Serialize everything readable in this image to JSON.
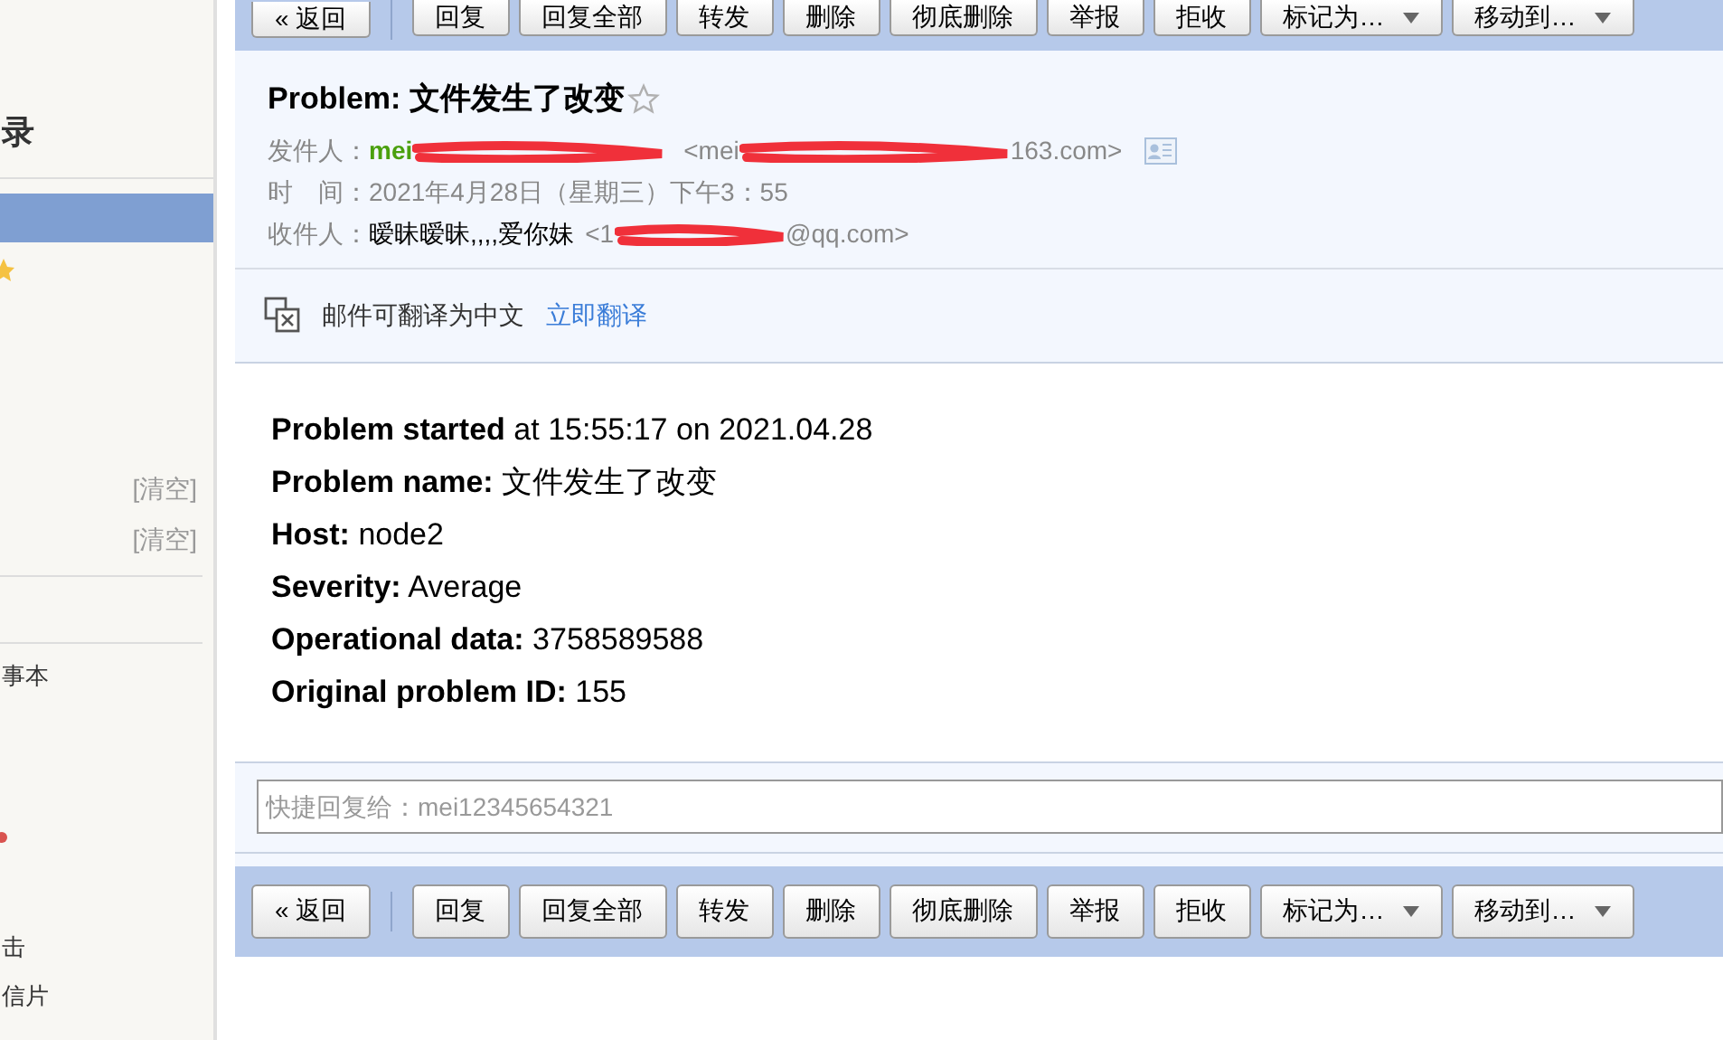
{
  "sidebar": {
    "title": "录",
    "items": [
      {
        "selected": true
      },
      {
        "kind": "star"
      }
    ],
    "clear_links": [
      "[清空]",
      "[清空]"
    ],
    "lower_items": [
      "事本",
      "击",
      "信片"
    ]
  },
  "top_toolbar": [
    {
      "label": "« 返回",
      "kind": "plain"
    },
    {
      "label": "回复",
      "kind": "plain"
    },
    {
      "label": "回复全部",
      "kind": "plain"
    },
    {
      "label": "转发",
      "kind": "plain"
    },
    {
      "label": "删除",
      "kind": "plain"
    },
    {
      "label": "彻底删除",
      "kind": "plain"
    },
    {
      "label": "举报",
      "kind": "plain"
    },
    {
      "label": "拒收",
      "kind": "plain"
    },
    {
      "label": "标记为…",
      "kind": "dropdown"
    },
    {
      "label": "移动到…",
      "kind": "dropdown"
    }
  ],
  "mail": {
    "subject": "Problem: 文件发生了改变",
    "starred": false,
    "from_label": "发件人：",
    "from_name": "mei",
    "from_email_start": "<mei",
    "from_email_end": "163.com>",
    "time_label": "时　间：",
    "time": "2021年4月28日（星期三）下午3：55",
    "to_label": "收件人：",
    "to_name": "暧昧暧昧,,,,爱你妹",
    "to_email_start": "<1",
    "to_email_end": "@qq.com>",
    "translate_note": "邮件可翻译为中文",
    "translate_link": "立即翻译",
    "body": [
      {
        "key": "Problem started",
        "value": "at 15:55:17 on 2021.04.28"
      },
      {
        "key": "Problem name:",
        "value": "文件发生了改变"
      },
      {
        "key": "Host:",
        "value": "node2"
      },
      {
        "key": "Severity:",
        "value": "Average"
      },
      {
        "key": "Operational data:",
        "value": "3758589588"
      },
      {
        "key": "Original problem ID:",
        "value": "155"
      }
    ]
  },
  "quick_reply": {
    "placeholder": "快捷回复给：mei12345654321"
  },
  "bottom_toolbar": [
    {
      "label": "« 返回",
      "kind": "plain"
    },
    {
      "label": "回复",
      "kind": "plain"
    },
    {
      "label": "回复全部",
      "kind": "plain"
    },
    {
      "label": "转发",
      "kind": "plain"
    },
    {
      "label": "删除",
      "kind": "plain"
    },
    {
      "label": "彻底删除",
      "kind": "plain"
    },
    {
      "label": "举报",
      "kind": "plain"
    },
    {
      "label": "拒收",
      "kind": "plain"
    },
    {
      "label": "标记为…",
      "kind": "dropdown"
    },
    {
      "label": "移动到…",
      "kind": "dropdown"
    }
  ]
}
